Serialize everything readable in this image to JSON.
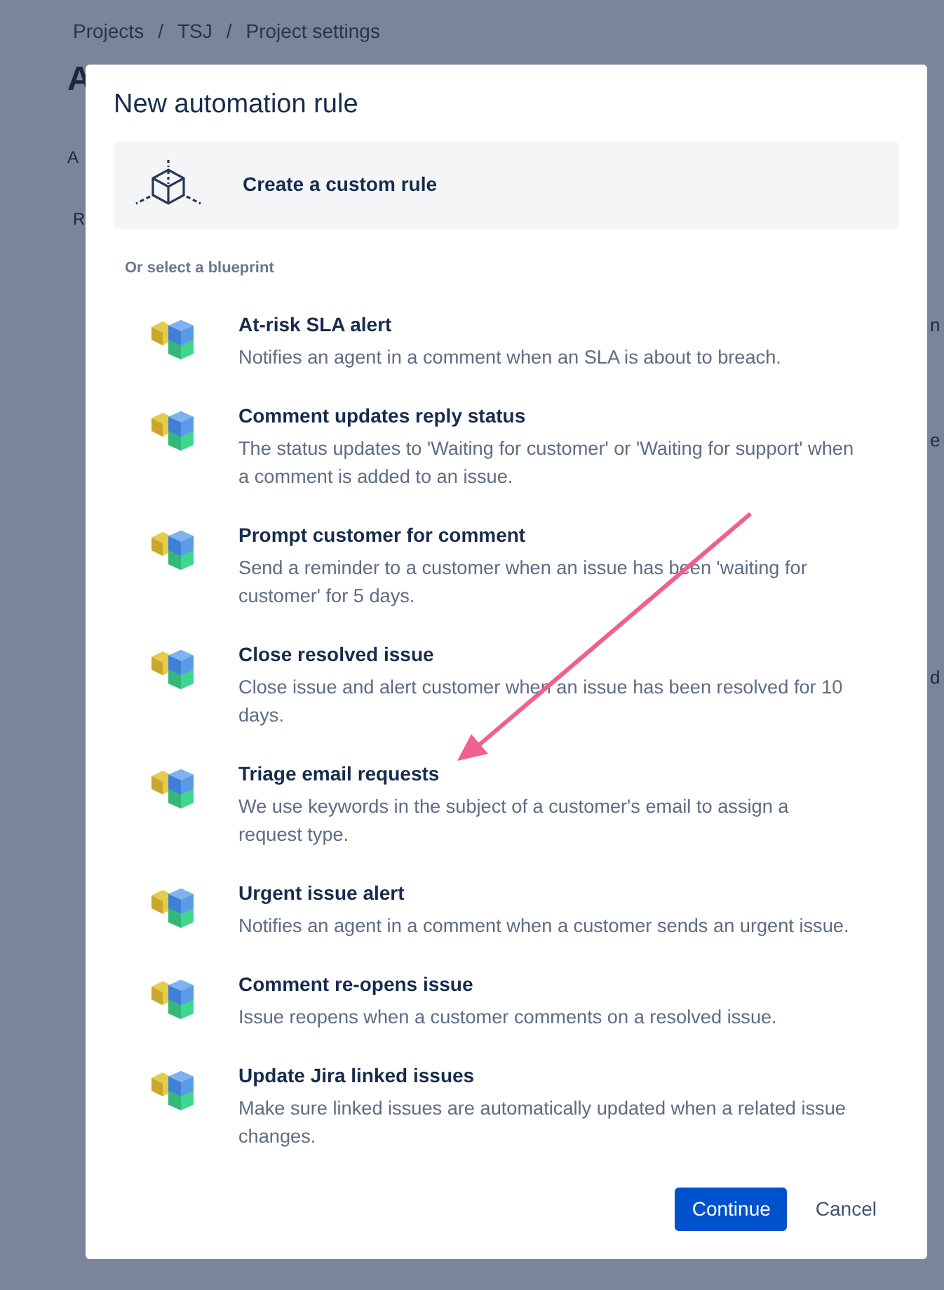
{
  "background": {
    "breadcrumbs": [
      "Projects",
      "TSJ",
      "Project settings"
    ],
    "separator": "/",
    "heading": "A",
    "left_fragments": [
      "A",
      "R"
    ],
    "right_fragments": [
      "n",
      "e",
      "d"
    ]
  },
  "dialog": {
    "title": "New automation rule",
    "custom_rule": {
      "label": "Create a custom rule"
    },
    "section_label": "Or select a blueprint",
    "blueprints": [
      {
        "title": "At-risk SLA alert",
        "description": "Notifies an agent in a comment when an SLA is about to breach."
      },
      {
        "title": "Comment updates reply status",
        "description": "The status updates to 'Waiting for customer' or 'Waiting for support' when a comment is added to an issue."
      },
      {
        "title": "Prompt customer for comment",
        "description": "Send a reminder to a customer when an issue has been 'waiting for customer' for 5 days."
      },
      {
        "title": "Close resolved issue",
        "description": "Close issue and alert customer when an issue has been resolved for 10 days."
      },
      {
        "title": "Triage email requests",
        "description": "We use keywords in the subject of a customer's email to assign a request type."
      },
      {
        "title": "Urgent issue alert",
        "description": "Notifies an agent in a comment when a customer sends an urgent issue."
      },
      {
        "title": "Comment re-opens issue",
        "description": "Issue reopens when a customer comments on a resolved issue."
      },
      {
        "title": "Update Jira linked issues",
        "description": "Make sure linked issues are automatically updated when a related issue changes."
      }
    ],
    "buttons": [
      {
        "label": "Continue",
        "kind": "primary"
      },
      {
        "label": "Cancel",
        "kind": "subtle"
      }
    ]
  },
  "annotation": {
    "kind": "arrow"
  }
}
